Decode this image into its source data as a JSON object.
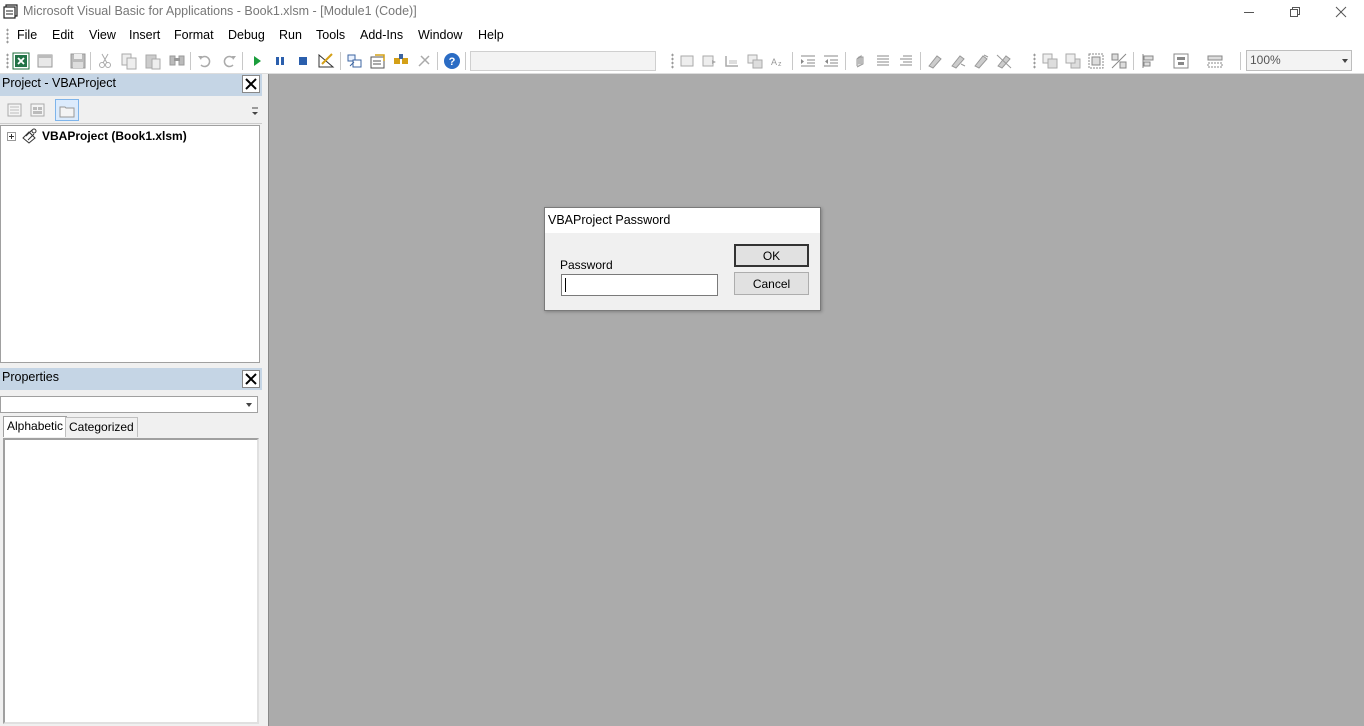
{
  "window": {
    "title": "Microsoft Visual Basic for Applications - Book1.xlsm - [Module1 (Code)]",
    "controls": [
      "minimize",
      "restore",
      "close"
    ]
  },
  "menu": {
    "items": [
      "File",
      "Edit",
      "View",
      "Insert",
      "Format",
      "Debug",
      "Run",
      "Tools",
      "Add-Ins",
      "Window",
      "Help"
    ]
  },
  "toolbar": {
    "zoom": "100%"
  },
  "project_panel": {
    "title": "Project - VBAProject",
    "tree_root": "VBAProject (Book1.xlsm)"
  },
  "properties_panel": {
    "title": "Properties",
    "object_selected": "",
    "tabs": [
      "Alphabetic",
      "Categorized"
    ],
    "active_tab": "Alphabetic"
  },
  "dialog": {
    "title": "VBAProject Password",
    "password_label": "Password",
    "password_value": "",
    "ok_label": "OK",
    "cancel_label": "Cancel"
  },
  "colors": {
    "panel_header": "#c5d5e5",
    "mdi_background": "#ababab",
    "window_background": "#f0f0f0"
  }
}
